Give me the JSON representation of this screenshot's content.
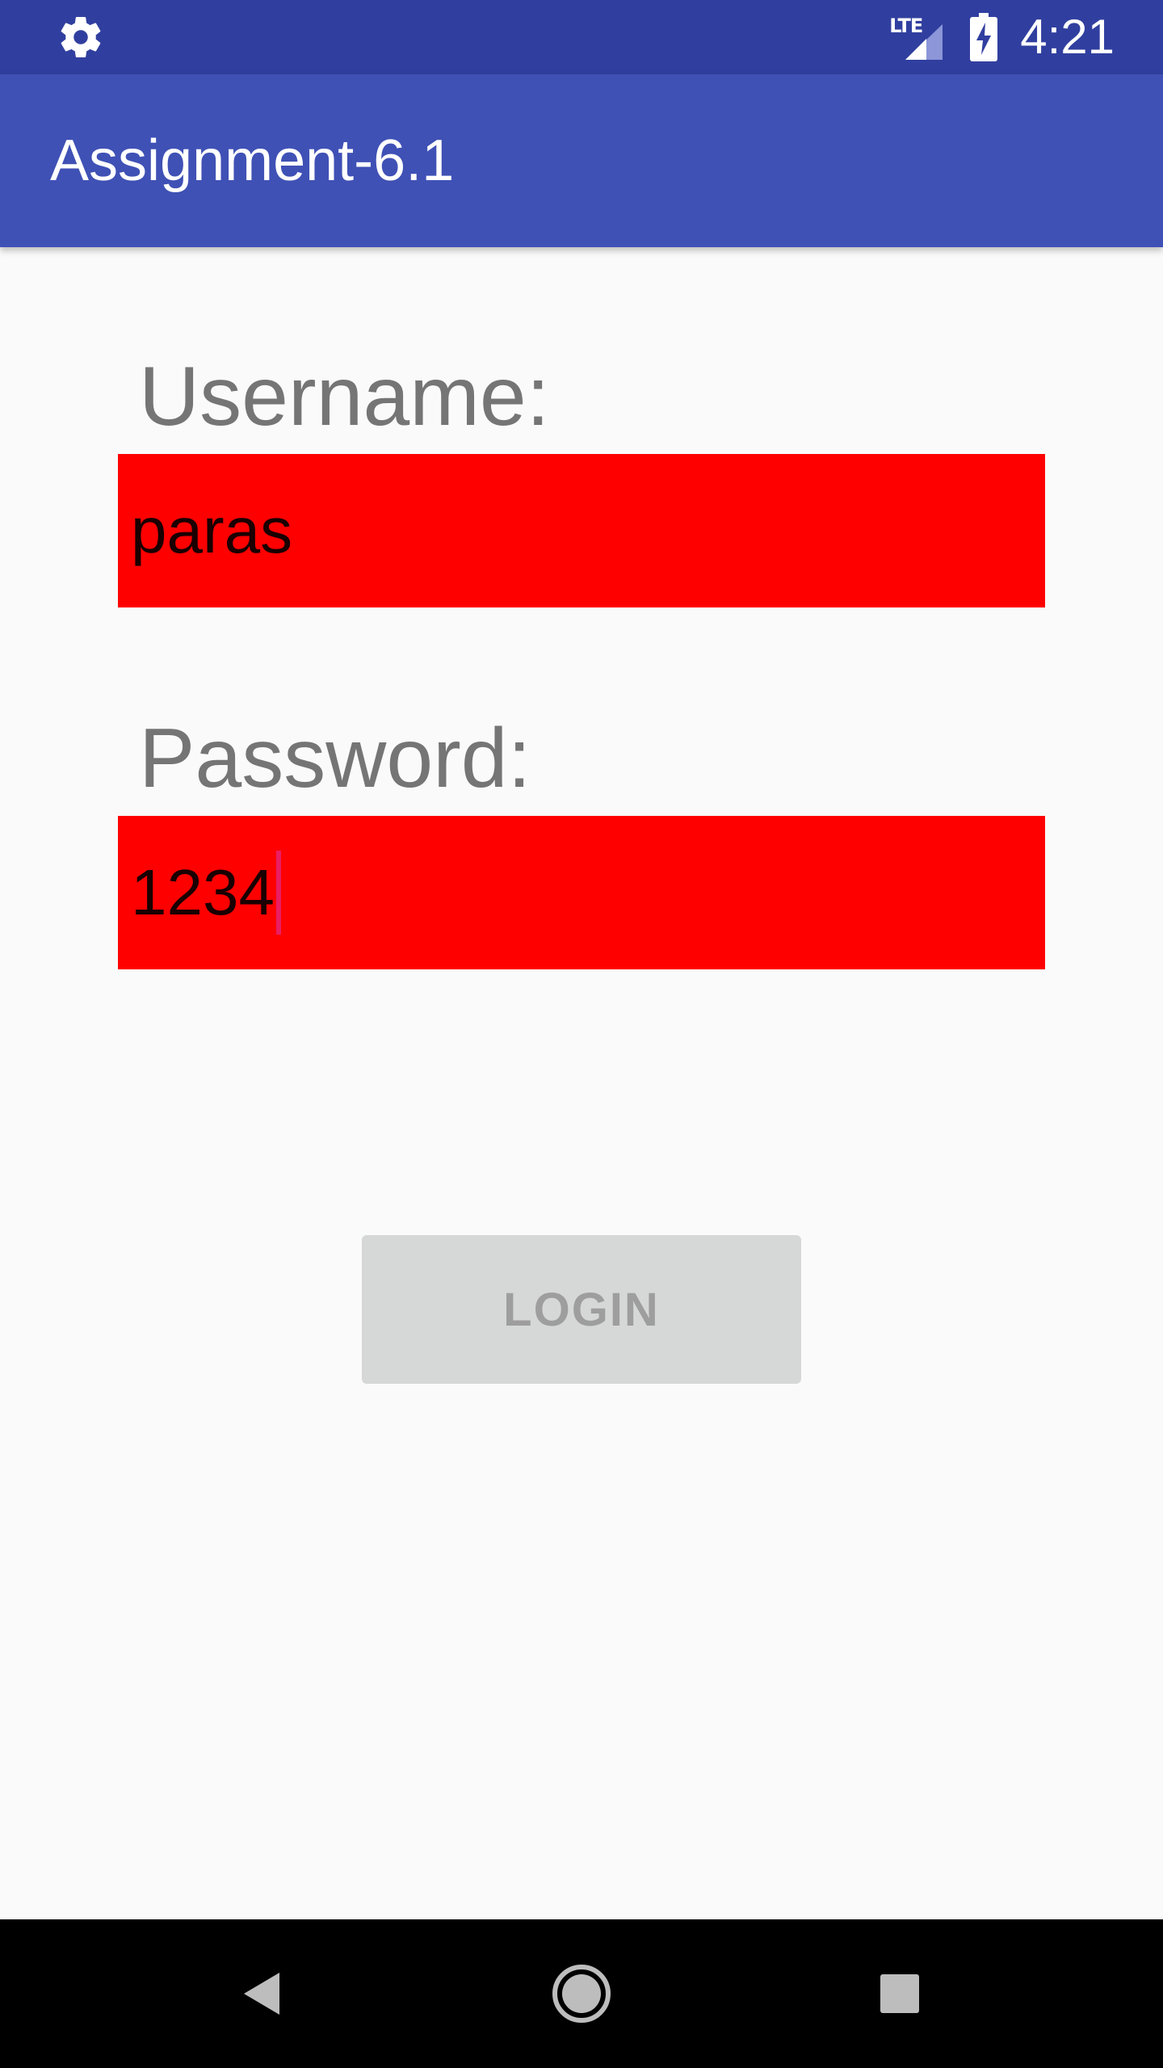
{
  "status_bar": {
    "network_label": "LTE",
    "time": "4:21",
    "icons": [
      "gear-icon",
      "lte-signal-icon",
      "battery-charging-icon"
    ]
  },
  "app_bar": {
    "title": "Assignment-6.1"
  },
  "form": {
    "username_label": "Username:",
    "username_value": "paras",
    "password_label": "Password:",
    "password_value": "1234",
    "field_background": "#ff0000",
    "login_label": "LOGIN"
  },
  "nav_bar": {
    "icons": [
      "back-icon",
      "home-icon",
      "recents-icon"
    ]
  },
  "colors": {
    "status_bar": "#303f9f",
    "app_bar": "#3f51b5",
    "cursor": "#e91e63"
  }
}
